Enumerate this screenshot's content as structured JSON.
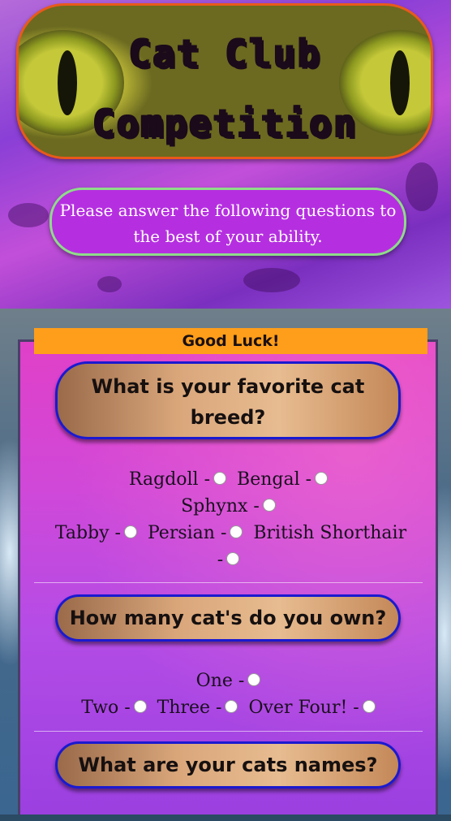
{
  "header": {
    "title_line1": "Cat Club",
    "title_line2": "Competition",
    "intro": "Please answer the following questions to the best of your ability."
  },
  "form": {
    "good_luck": "Good Luck!",
    "questions": [
      {
        "text": "What is your favorite cat breed?",
        "options": [
          "Ragdoll -",
          "Bengal -",
          "Sphynx -",
          "Tabby -",
          "Persian -",
          "British Shorthair -"
        ]
      },
      {
        "text": "How many cat's do you own?",
        "options": [
          "One -",
          "Two -",
          "Three -",
          "Over Four! -"
        ]
      },
      {
        "text": "What are your cats names?"
      }
    ]
  },
  "colors": {
    "good_luck_bar": "#ff9e1a",
    "question_border": "#1a1ad0",
    "intro_border": "#8fdc8a",
    "banner_border": "#e85a1a"
  }
}
